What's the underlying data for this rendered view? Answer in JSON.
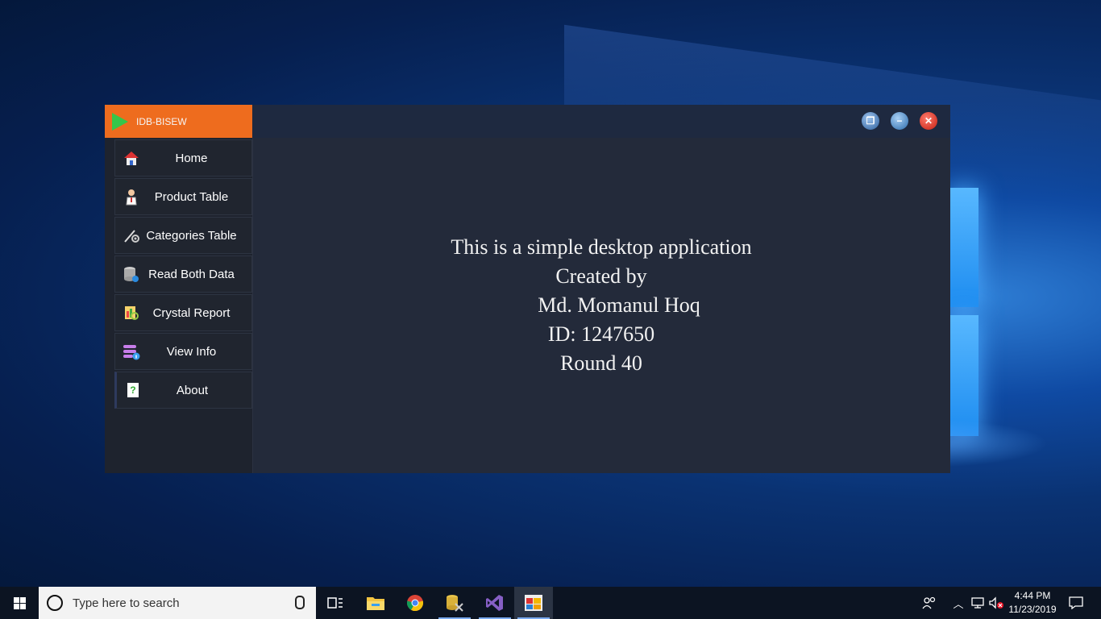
{
  "app": {
    "title": "IDB-BISEW",
    "nav": [
      {
        "label": "Home",
        "icon": "house-icon"
      },
      {
        "label": "Product Table",
        "icon": "person-icon"
      },
      {
        "label": "Categories Table",
        "icon": "tools-icon"
      },
      {
        "label": "Read Both Data",
        "icon": "database-icon"
      },
      {
        "label": "Crystal Report",
        "icon": "report-icon"
      },
      {
        "label": "View Info",
        "icon": "info-stack-icon"
      },
      {
        "label": "About",
        "icon": "help-document-icon"
      }
    ],
    "active_nav": "About",
    "content_lines": [
      "This is a simple desktop application",
      "Created by",
      "Md. Momanul Hoq",
      "ID: 1247650",
      "Round 40"
    ],
    "window_controls": [
      "restore-icon",
      "minimize-icon",
      "close-icon"
    ],
    "colors": {
      "brand": "#ee6c1e",
      "play": "#35c64a",
      "panel": "#232a3a",
      "sidebar": "#1e232e"
    }
  },
  "taskbar": {
    "search_placeholder": "Type here to search",
    "apps": [
      "task-view-icon",
      "file-explorer-icon",
      "chrome-icon",
      "sql-tools-icon",
      "visual-studio-icon",
      "app-window-icon"
    ],
    "time": "4:44 PM",
    "date": "11/23/2019"
  }
}
